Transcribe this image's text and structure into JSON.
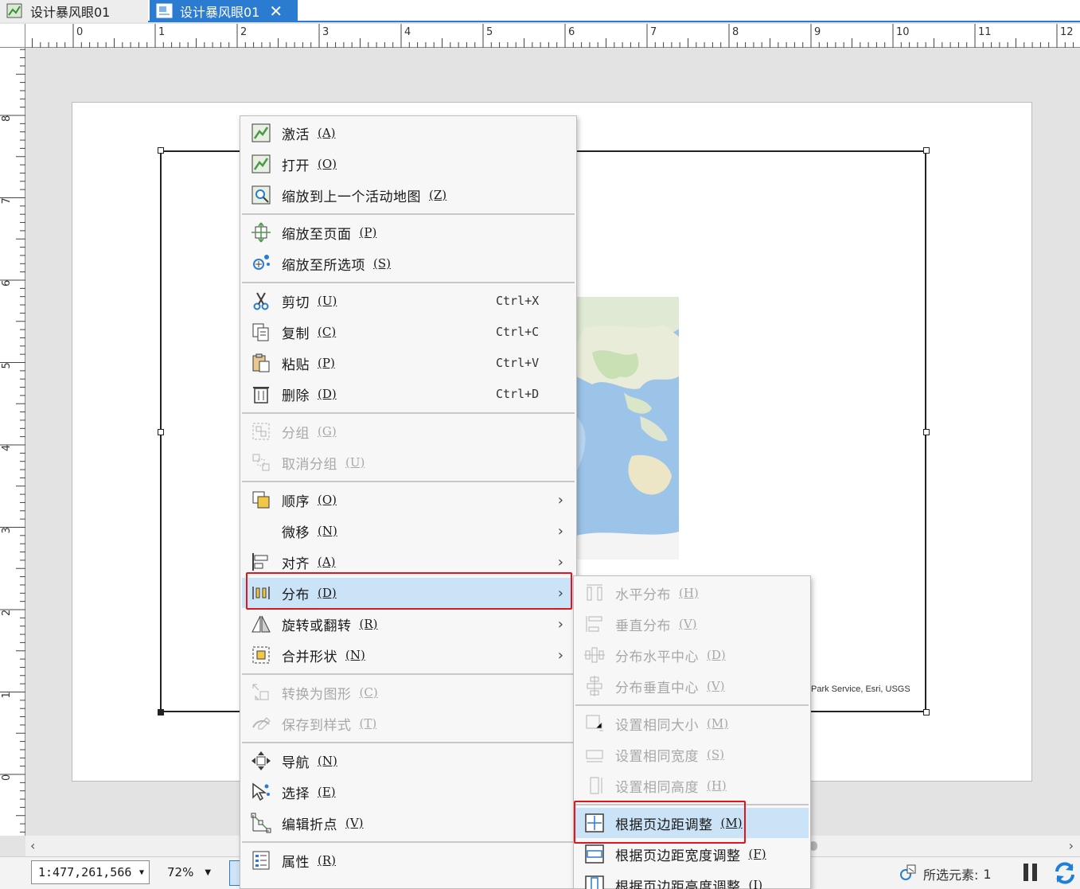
{
  "tabs": [
    {
      "label": "设计暴风眼01",
      "active": false
    },
    {
      "label": "设计暴风眼01",
      "active": true
    }
  ],
  "ruler": {
    "horizontal": [
      "0",
      "1",
      "2",
      "3",
      "4",
      "5",
      "6",
      "7",
      "8",
      "9",
      "10",
      "11",
      "12"
    ],
    "vertical": [
      "8",
      "7",
      "6",
      "5",
      "4",
      "3",
      "2",
      "1",
      "0"
    ]
  },
  "map": {
    "credits": "Park Service, Esri, USGS"
  },
  "context_menu": {
    "groups": [
      [
        {
          "icon": "map-frame-icon",
          "label": "激活",
          "accel": "(A)",
          "enabled": true
        },
        {
          "icon": "map-frame-icon",
          "label": "打开",
          "accel": "(O)",
          "enabled": true
        },
        {
          "icon": "zoom-previous-map-icon",
          "label": "缩放到上一个活动地图",
          "accel": "(Z)",
          "enabled": true
        }
      ],
      [
        {
          "icon": "zoom-to-page-icon",
          "label": "缩放至页面",
          "accel": "(P)",
          "enabled": true
        },
        {
          "icon": "zoom-to-selected-icon",
          "label": "缩放至所选项",
          "accel": "(S)",
          "enabled": true
        }
      ],
      [
        {
          "icon": "scissors-icon",
          "label": "剪切",
          "accel": "(U)",
          "shortcut": "Ctrl+X",
          "enabled": true
        },
        {
          "icon": "copy-icon",
          "label": "复制",
          "accel": "(C)",
          "shortcut": "Ctrl+C",
          "enabled": true
        },
        {
          "icon": "paste-icon",
          "label": "粘贴",
          "accel": "(P)",
          "shortcut": "Ctrl+V",
          "enabled": true
        },
        {
          "icon": "trash-icon",
          "label": "删除",
          "accel": "(D)",
          "shortcut": "Ctrl+D",
          "enabled": true
        }
      ],
      [
        {
          "icon": "group-icon",
          "label": "分组",
          "accel": "(G)",
          "enabled": false
        },
        {
          "icon": "ungroup-icon",
          "label": "取消分组",
          "accel": "(U)",
          "enabled": false
        }
      ],
      [
        {
          "icon": "order-icon",
          "label": "顺序",
          "accel": "(O)",
          "submenu": true,
          "enabled": true
        },
        {
          "icon": "",
          "label": "微移",
          "accel": "(N)",
          "submenu": true,
          "enabled": true
        },
        {
          "icon": "align-icon",
          "label": "对齐",
          "accel": "(A)",
          "submenu": true,
          "enabled": true
        },
        {
          "icon": "distribute-icon",
          "label": "分布",
          "accel": "(D)",
          "submenu": true,
          "enabled": true,
          "highlighted": true
        },
        {
          "icon": "rotate-flip-icon",
          "label": "旋转或翻转",
          "accel": "(R)",
          "submenu": true,
          "enabled": true
        },
        {
          "icon": "merge-shapes-icon",
          "label": "合并形状",
          "accel": "(N)",
          "submenu": true,
          "enabled": true
        }
      ],
      [
        {
          "icon": "convert-graphic-icon",
          "label": "转换为图形",
          "accel": "(C)",
          "enabled": false
        },
        {
          "icon": "save-style-icon",
          "label": "保存到样式",
          "accel": "(T)",
          "enabled": false
        }
      ],
      [
        {
          "icon": "navigate-icon",
          "label": "导航",
          "accel": "(N)",
          "enabled": true
        },
        {
          "icon": "select-icon",
          "label": "选择",
          "accel": "(E)",
          "enabled": true
        },
        {
          "icon": "edit-vertices-icon",
          "label": "编辑折点",
          "accel": "(V)",
          "enabled": true
        }
      ],
      [
        {
          "icon": "properties-icon",
          "label": "属性",
          "accel": "(R)",
          "enabled": true
        }
      ]
    ]
  },
  "submenu": {
    "groups": [
      [
        {
          "icon": "distribute-horizontal-icon",
          "label": "水平分布",
          "accel": "(H)",
          "enabled": false
        },
        {
          "icon": "distribute-vertical-icon",
          "label": "垂直分布",
          "accel": "(V)",
          "enabled": false
        },
        {
          "icon": "distribute-h-center-icon",
          "label": "分布水平中心",
          "accel": "(D)",
          "enabled": false
        },
        {
          "icon": "distribute-v-center-icon",
          "label": "分布垂直中心",
          "accel": "(V)",
          "enabled": false
        }
      ],
      [
        {
          "icon": "same-size-icon",
          "label": "设置相同大小",
          "accel": "(M)",
          "enabled": false
        },
        {
          "icon": "same-width-icon",
          "label": "设置相同宽度",
          "accel": "(S)",
          "enabled": false
        },
        {
          "icon": "same-height-icon",
          "label": "设置相同高度",
          "accel": "(H)",
          "enabled": false
        }
      ],
      [
        {
          "icon": "fit-to-margins-icon",
          "label": "根据页边距调整",
          "accel": "(M)",
          "enabled": true,
          "highlighted": true
        },
        {
          "icon": "fit-margin-width-icon",
          "label": "根据页边距宽度调整",
          "accel": "(F)",
          "enabled": true
        },
        {
          "icon": "fit-margin-height-icon",
          "label": "根据页边距高度调整",
          "accel": "(I)",
          "enabled": true
        }
      ]
    ]
  },
  "statusbar": {
    "scale": "1:477,261,566",
    "zoom": "72%",
    "selected_label": "所选元素:",
    "selected_count": "1"
  },
  "colors": {
    "accent": "#2b7bd0",
    "highlight": "#cbe3f7",
    "annotation_red": "#e0161c",
    "disabled_text": "#a8a8a8"
  }
}
